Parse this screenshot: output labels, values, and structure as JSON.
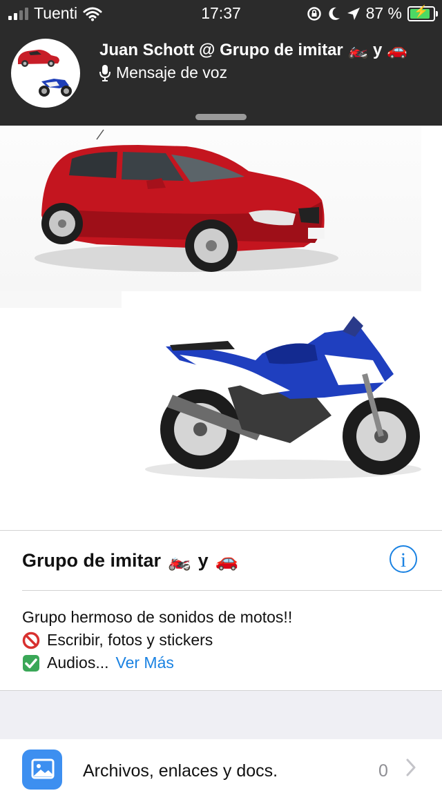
{
  "status_bar": {
    "carrier": "Tuenti",
    "time": "17:37",
    "battery_percent": "87 %"
  },
  "header": {
    "title": "Juan Schott @ Grupo de imitar 🏍️ y 🚗",
    "subtitle": "Mensaje de voz"
  },
  "group": {
    "name": "Grupo de imitar",
    "name_conj": "y",
    "description_line1": "Grupo hermoso de sonidos de motos!!",
    "description_line2": "Escribir, fotos y stickers",
    "description_line3": "Audios...",
    "see_more": "Ver Más"
  },
  "files_row": {
    "label": "Archivos, enlaces y docs.",
    "count": "0"
  },
  "colors": {
    "header_bg": "#2b2b2b",
    "accent": "#1a82e2",
    "battery_green": "#4cd964",
    "gray_bg": "#efeff4"
  },
  "icons": [
    "signal-icon",
    "wifi-icon",
    "rotation-lock-icon",
    "moon-icon",
    "location-icon",
    "battery-icon",
    "microphone-icon",
    "info-icon",
    "photo-library-icon",
    "chevron-right-icon"
  ]
}
